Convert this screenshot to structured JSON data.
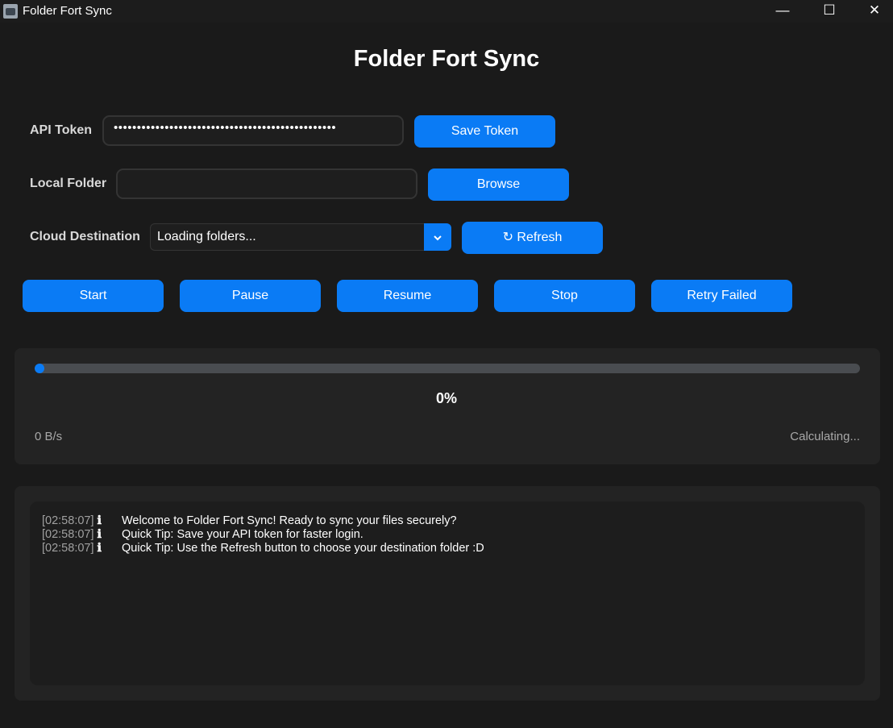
{
  "window": {
    "title": "Folder Fort Sync",
    "app_icon": "app-icon",
    "controls": {
      "minimize": "—",
      "maximize": "☐",
      "close": "✕"
    }
  },
  "app": {
    "title": "Folder Fort Sync"
  },
  "form": {
    "api_token": {
      "label": "API Token",
      "value": "••••••••••••••••••••••••••••••••••••••••••••••••",
      "button": "Save Token"
    },
    "local_folder": {
      "label": "Local Folder",
      "value": "",
      "button": "Browse"
    },
    "cloud_destination": {
      "label": "Cloud Destination",
      "selected": "Loading folders...",
      "dropdown_icon": "chevron-down-icon",
      "button": "↻ Refresh"
    }
  },
  "actions": {
    "start": "Start",
    "pause": "Pause",
    "resume": "Resume",
    "stop": "Stop",
    "retry": "Retry Failed"
  },
  "progress": {
    "percent_value": 0,
    "percent_label": "0%",
    "speed": "0 B/s",
    "eta": "Calculating..."
  },
  "log": [
    {
      "time": "[02:58:07]",
      "icon": "ℹ",
      "message": "Welcome to Folder Fort Sync! Ready to sync your files securely?"
    },
    {
      "time": "[02:58:07]",
      "icon": "ℹ",
      "message": "Quick Tip: Save your API token for faster login."
    },
    {
      "time": "[02:58:07]",
      "icon": "ℹ",
      "message": "Quick Tip: Use the Refresh button to choose your destination folder :D"
    }
  ],
  "colors": {
    "accent": "#0a7bf5",
    "background": "#1a1a1a",
    "panel": "#232323",
    "track": "#494c50"
  }
}
